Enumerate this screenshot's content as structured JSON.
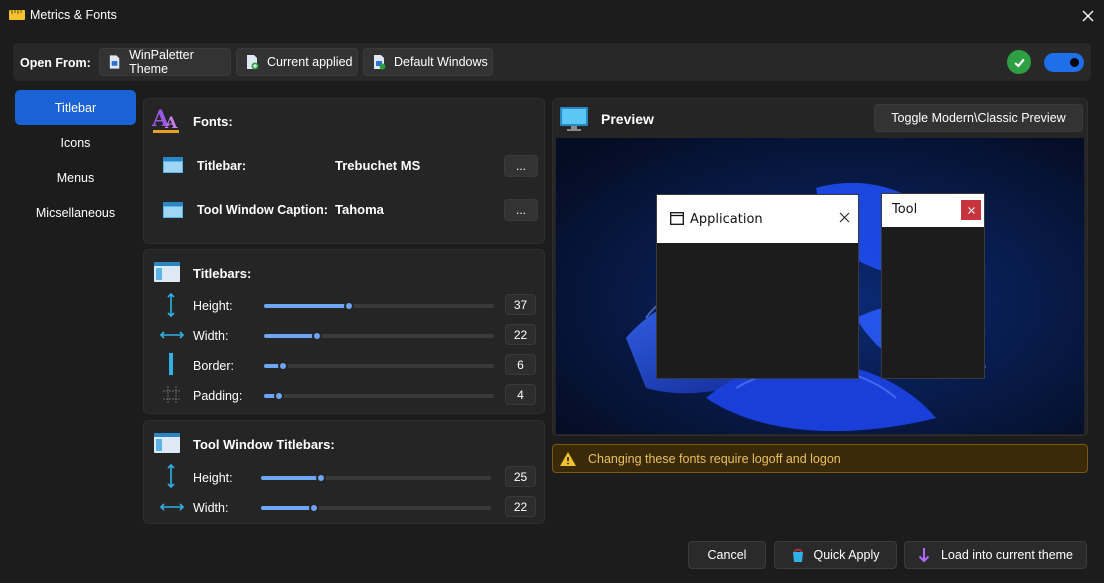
{
  "window": {
    "title": "Metrics & Fonts",
    "close_icon": "close-icon"
  },
  "open_from": {
    "label": "Open From:",
    "sources": [
      "WinPaletter Theme",
      "Current applied",
      "Default Windows"
    ]
  },
  "nav": [
    "Titlebar",
    "Icons",
    "Menus",
    "Micsellaneous"
  ],
  "fonts": {
    "heading": "Fonts:",
    "rows": [
      {
        "label": "Titlebar:",
        "value": "Trebuchet MS",
        "button": "..."
      },
      {
        "label": "Tool Window Caption:",
        "value": "Tahoma",
        "button": "..."
      }
    ]
  },
  "titlebars": {
    "heading": "Titlebars:",
    "sliders": [
      {
        "label": "Height:",
        "value": "37",
        "fraction": 0.37
      },
      {
        "label": "Width:",
        "value": "22",
        "fraction": 0.23
      },
      {
        "label": "Border:",
        "value": "6",
        "fraction": 0.08
      },
      {
        "label": "Padding:",
        "value": "4",
        "fraction": 0.06
      }
    ]
  },
  "tool_titlebars": {
    "heading": "Tool Window Titlebars:",
    "sliders": [
      {
        "label": "Height:",
        "value": "25",
        "fraction": 0.26
      },
      {
        "label": "Width:",
        "value": "22",
        "fraction": 0.23
      }
    ]
  },
  "preview": {
    "title": "Preview",
    "toggle_button": "Toggle Modern\\Classic Preview",
    "app_window_title": "Application",
    "tool_window_title": "Tool"
  },
  "warning": "Changing these fonts require logoff and logon",
  "footer": {
    "cancel": "Cancel",
    "quick_apply": "Quick Apply",
    "load": "Load into current theme"
  },
  "colors": {
    "accent": "#1963d6",
    "slider": "#6ea6f7",
    "ok": "#2ea043",
    "warning_text": "#e8c060"
  }
}
